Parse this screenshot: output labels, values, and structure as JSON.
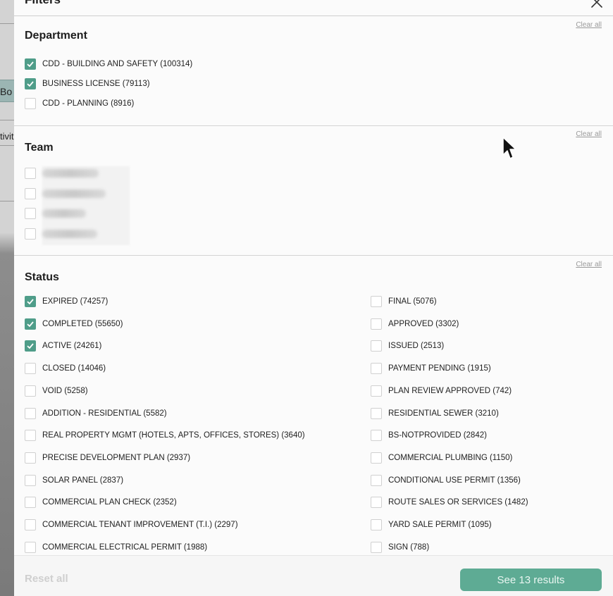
{
  "background": {
    "button_label": "Bo",
    "text_fragment": "tivit"
  },
  "drawer": {
    "title": "Filters"
  },
  "department": {
    "title": "Department",
    "clear_label": "Clear all",
    "options": [
      {
        "label": "CDD - BUILDING AND SAFETY (100314)",
        "checked": true
      },
      {
        "label": "BUSINESS LICENSE (79113)",
        "checked": true
      },
      {
        "label": "CDD - PLANNING (8916)",
        "checked": false
      }
    ]
  },
  "team": {
    "title": "Team",
    "clear_label": "Clear all"
  },
  "status": {
    "title": "Status",
    "clear_label": "Clear all",
    "left": [
      {
        "label": "EXPIRED (74257)",
        "checked": true
      },
      {
        "label": "COMPLETED (55650)",
        "checked": true
      },
      {
        "label": "ACTIVE (24261)",
        "checked": true
      },
      {
        "label": "CLOSED (14046)",
        "checked": false
      },
      {
        "label": "VOID (5258)",
        "checked": false
      },
      {
        "label": "ADDITION - RESIDENTIAL (5582)",
        "checked": false
      },
      {
        "label": "REAL PROPERTY MGMT (HOTELS, APTS, OFFICES, STORES) (3640)",
        "checked": false
      },
      {
        "label": "PRECISE DEVELOPMENT PLAN (2937)",
        "checked": false
      },
      {
        "label": "SOLAR PANEL (2837)",
        "checked": false
      },
      {
        "label": "COMMERCIAL PLAN CHECK (2352)",
        "checked": false
      },
      {
        "label": "COMMERCIAL TENANT IMPROVEMENT (T.I.) (2297)",
        "checked": false
      },
      {
        "label": "COMMERCIAL ELECTRICAL PERMIT (1988)",
        "checked": false
      }
    ],
    "right": [
      {
        "label": "FINAL (5076)",
        "checked": false
      },
      {
        "label": "APPROVED (3302)",
        "checked": false
      },
      {
        "label": "ISSUED (2513)",
        "checked": false
      },
      {
        "label": "PAYMENT PENDING (1915)",
        "checked": false
      },
      {
        "label": "PLAN REVIEW APPROVED (742)",
        "checked": false
      },
      {
        "label": " RESIDENTIAL SEWER (3210)",
        "checked": false
      },
      {
        "label": "BS-NOTPROVIDED (2842)",
        "checked": false
      },
      {
        "label": "COMMERCIAL PLUMBING (1150)",
        "checked": false
      },
      {
        "label": "CONDITIONAL USE PERMIT (1356)",
        "checked": false
      },
      {
        "label": "ROUTE SALES OR SERVICES (1482)",
        "checked": false
      },
      {
        "label": "YARD SALE PERMIT (1095)",
        "checked": false
      },
      {
        "label": "SIGN (788)",
        "checked": false
      }
    ]
  },
  "footer": {
    "reset_label": "Reset all",
    "results_label": "See 13 results"
  },
  "colors": {
    "accent": "#5eab94",
    "checkbox_checked": "#4f9d89"
  }
}
